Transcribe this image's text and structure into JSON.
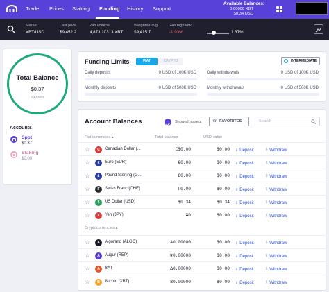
{
  "nav": {
    "items": [
      "Trade",
      "Prices",
      "Staking",
      "Funding",
      "History",
      "Support"
    ],
    "active": "Funding",
    "available_title": "Available Balances:",
    "available_xbt": "0.00000 XBT",
    "available_usd": "$0.34 USD"
  },
  "ticker": {
    "market_label": "Market",
    "market_value": "XBT/USD",
    "last_label": "Last price",
    "last_value": "$9,452.2",
    "vol_label": "24h volume",
    "vol_value": "4,873.10313 XBT",
    "wavg_label": "Weighted avg.",
    "wavg_value": "$9,415.7",
    "hl_label": "24h high/low",
    "hl_low": "-1.93%",
    "hl_high": "1.37%",
    "range_position": 0.3
  },
  "summary": {
    "title": "Total Balance",
    "amount": "$0.37",
    "assets": "3 Assets",
    "accounts_title": "Accounts",
    "accounts": [
      {
        "name": "Spot",
        "value": "$0.37"
      },
      {
        "name": "Staking",
        "value": "$0.00"
      }
    ]
  },
  "funding": {
    "title": "Funding Limits",
    "fiat_label": "FIAT",
    "crypto_label": "CRYPTO",
    "tier_label": "INTERMEDIATE",
    "rows": [
      {
        "label": "Daily deposits",
        "value": "0 USD of 100K USD"
      },
      {
        "label": "Daily withdrawals",
        "value": "0 USD of 100K USD"
      },
      {
        "label": "Monthly deposits",
        "value": "0 USD of 500K USD"
      },
      {
        "label": "Monthly withdrawals",
        "value": "0 USD of 500K USD"
      }
    ]
  },
  "balances": {
    "title": "Account Balances",
    "show_all": "Show all assets",
    "favorites": "FAVORITES",
    "search_placeholder": "Search",
    "fiat_header": "Fiat currencies ▴",
    "col_total": "Total balance",
    "col_usd": "USD value",
    "crypto_header": "Cryptocurrencies ▴",
    "deposit_label": "Deposit",
    "withdraw_label": "Withdraw",
    "fiat": [
      {
        "symbol": "C",
        "name": "Canadian Dollar (...",
        "balance": "C$0.00",
        "usd": "$0.00",
        "color": "#d93a3a"
      },
      {
        "symbol": "€",
        "name": "Euro (EUR)",
        "balance": "€0.00",
        "usd": "$0.00",
        "color": "#2a3ea8"
      },
      {
        "symbol": "£",
        "name": "Pound Sterling (G...",
        "balance": "£0.00",
        "usd": "$0.00",
        "color": "#2a3ea8"
      },
      {
        "symbol": "F",
        "name": "Swiss Franc (CHF)",
        "balance": "F0.00",
        "usd": "$0.00",
        "color": "#2d2d2d"
      },
      {
        "symbol": "$",
        "name": "US Dollar (USD)",
        "balance": "$0.34",
        "usd": "$0.34",
        "color": "#27a058"
      },
      {
        "symbol": "¥",
        "name": "Yen (JPY)",
        "balance": "¥0",
        "usd": "$0.00",
        "color": "#d93a3a"
      }
    ],
    "crypto": [
      {
        "symbol": "A",
        "name": "Algorand (ALGO)",
        "balance": "A0.00000",
        "usd": "$0.00",
        "color": "#1b1b2a"
      },
      {
        "symbol": "A",
        "name": "Augur (REP)",
        "balance": "Ʀ0.00000",
        "usd": "$0.00",
        "color": "#5b3bd6"
      },
      {
        "symbol": "A",
        "name": "BAT",
        "balance": "Δ0.00000",
        "usd": "$0.00",
        "color": "#e2562a"
      },
      {
        "symbol": "B",
        "name": "Bitcoin (XBT)",
        "balance": "Ƀ0.00000",
        "usd": "$0.00",
        "color": "#f2a431"
      }
    ]
  }
}
